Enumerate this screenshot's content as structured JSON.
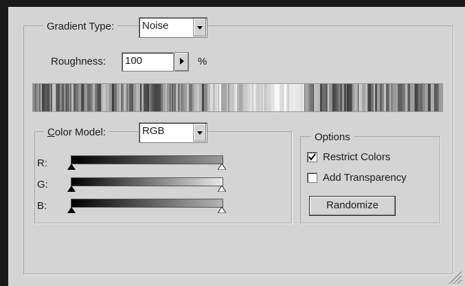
{
  "gradient_type": {
    "label": "Gradient Type:",
    "value": "Noise"
  },
  "roughness": {
    "label": "Roughness:",
    "value": "100",
    "unit": "%"
  },
  "color_model": {
    "label": "Color Model:",
    "value": "RGB",
    "channels": [
      {
        "label": "R:",
        "track_end_color": "#ff0000"
      },
      {
        "label": "G:",
        "track_end_color": "#00ff00"
      },
      {
        "label": "B:",
        "track_end_color": "#0000ff"
      }
    ]
  },
  "options": {
    "label": "Options",
    "restrict_colors": {
      "label": "Restrict Colors",
      "checked": true
    },
    "add_transparency": {
      "label": "Add Transparency",
      "checked": false
    },
    "randomize_label": "Randomize"
  },
  "colors": {
    "dialog_bg": "#d4d4d4",
    "groove": "#a8a8a8"
  }
}
